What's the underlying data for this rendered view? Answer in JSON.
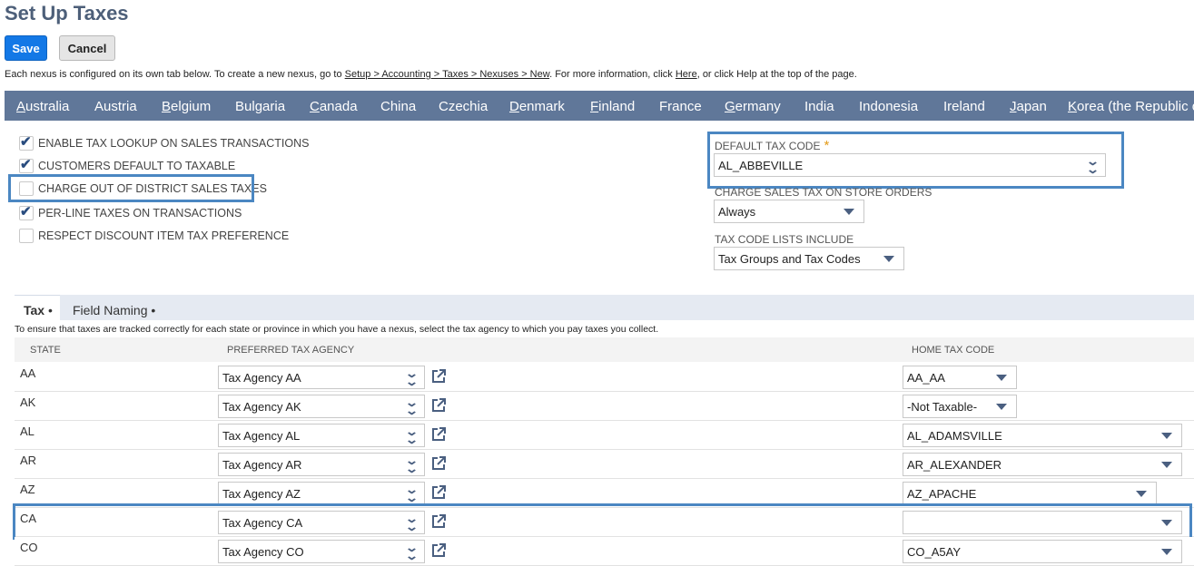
{
  "page": {
    "title": "Set Up Taxes"
  },
  "toolbar": {
    "save_label": "Save",
    "cancel_label": "Cancel"
  },
  "info": {
    "prefix": "Each nexus is configured on its own tab below. To create a new nexus, go to ",
    "path_link": "Setup > Accounting > Taxes > Nexuses > New",
    "middle": ". For more information, click ",
    "here_link": "Here",
    "suffix": ", or click Help at the top of the page."
  },
  "countries": [
    {
      "first": "A",
      "rest": "ustralia"
    },
    {
      "first": "A",
      "rest": "ustria",
      "underline_index": 1
    },
    {
      "first": "B",
      "rest": "elgium"
    },
    {
      "first": "B",
      "rest": "ulgaria"
    },
    {
      "first": "C",
      "rest": "anada"
    },
    {
      "first": "C",
      "rest": "hina"
    },
    {
      "first": "C",
      "rest": "zechia"
    },
    {
      "first": "D",
      "rest": "enmark"
    },
    {
      "first": "F",
      "rest": "inland"
    },
    {
      "first": "F",
      "rest": "rance"
    },
    {
      "first": "G",
      "rest": "ermany"
    },
    {
      "first": "I",
      "rest": "ndia"
    },
    {
      "first": "I",
      "rest": "ndonesia"
    },
    {
      "first": "I",
      "rest": "reland"
    },
    {
      "first": "J",
      "rest": "apan"
    },
    {
      "first": "K",
      "rest": "orea (the Republic of)"
    }
  ],
  "checkboxes": [
    {
      "label": "ENABLE TAX LOOKUP ON SALES TRANSACTIONS",
      "checked": true
    },
    {
      "label": "CUSTOMERS DEFAULT TO TAXABLE",
      "checked": true
    },
    {
      "label": "CHARGE OUT OF DISTRICT SALES TAXES",
      "checked": false
    },
    {
      "label": "PER-LINE TAXES ON TRANSACTIONS",
      "checked": true
    },
    {
      "label": "RESPECT DISCOUNT ITEM TAX PREFERENCE",
      "checked": false
    }
  ],
  "check_glyph": "✔",
  "default_tax_code": {
    "label": "DEFAULT TAX CODE",
    "required_mark": "*",
    "value": "AL_ABBEVILLE"
  },
  "charge_sales_tax": {
    "label": "CHARGE SALES TAX ON STORE ORDERS",
    "value": "Always"
  },
  "tax_code_lists": {
    "label": "TAX CODE LISTS INCLUDE",
    "value": "Tax Groups and Tax Codes"
  },
  "subtabs": {
    "tax": "Tax",
    "field_naming": "Field Naming",
    "dot": "•"
  },
  "tab_note": "To ensure that taxes are tracked correctly for each state or province in which you have a nexus, select the tax agency to which you pay taxes you collect.",
  "columns": {
    "state": "STATE",
    "agency": "PREFERRED TAX AGENCY",
    "home_code": "HOME TAX CODE"
  },
  "rows": [
    {
      "state": "AA",
      "agency": "Tax Agency AA",
      "home_code": "AA_AA"
    },
    {
      "state": "AK",
      "agency": "Tax Agency AK",
      "home_code": "-Not Taxable-"
    },
    {
      "state": "AL",
      "agency": "Tax Agency AL",
      "home_code": "AL_ADAMSVILLE"
    },
    {
      "state": "AR",
      "agency": "Tax Agency AR",
      "home_code": "AR_ALEXANDER"
    },
    {
      "state": "AZ",
      "agency": "Tax Agency AZ",
      "home_code": "AZ_APACHE"
    },
    {
      "state": "CA",
      "agency": "Tax Agency CA",
      "home_code": ""
    },
    {
      "state": "CO",
      "agency": "Tax Agency CO",
      "home_code": "CO_A5AY"
    }
  ],
  "icons": {
    "checkbox": "check-icon",
    "dropdown": "chevron-down-icon",
    "open": "external-link-icon"
  },
  "colors": {
    "nav_bar": "#607799",
    "primary_button": "#1378e6",
    "highlight_box": "#4b87c2",
    "required": "#e39b19"
  }
}
